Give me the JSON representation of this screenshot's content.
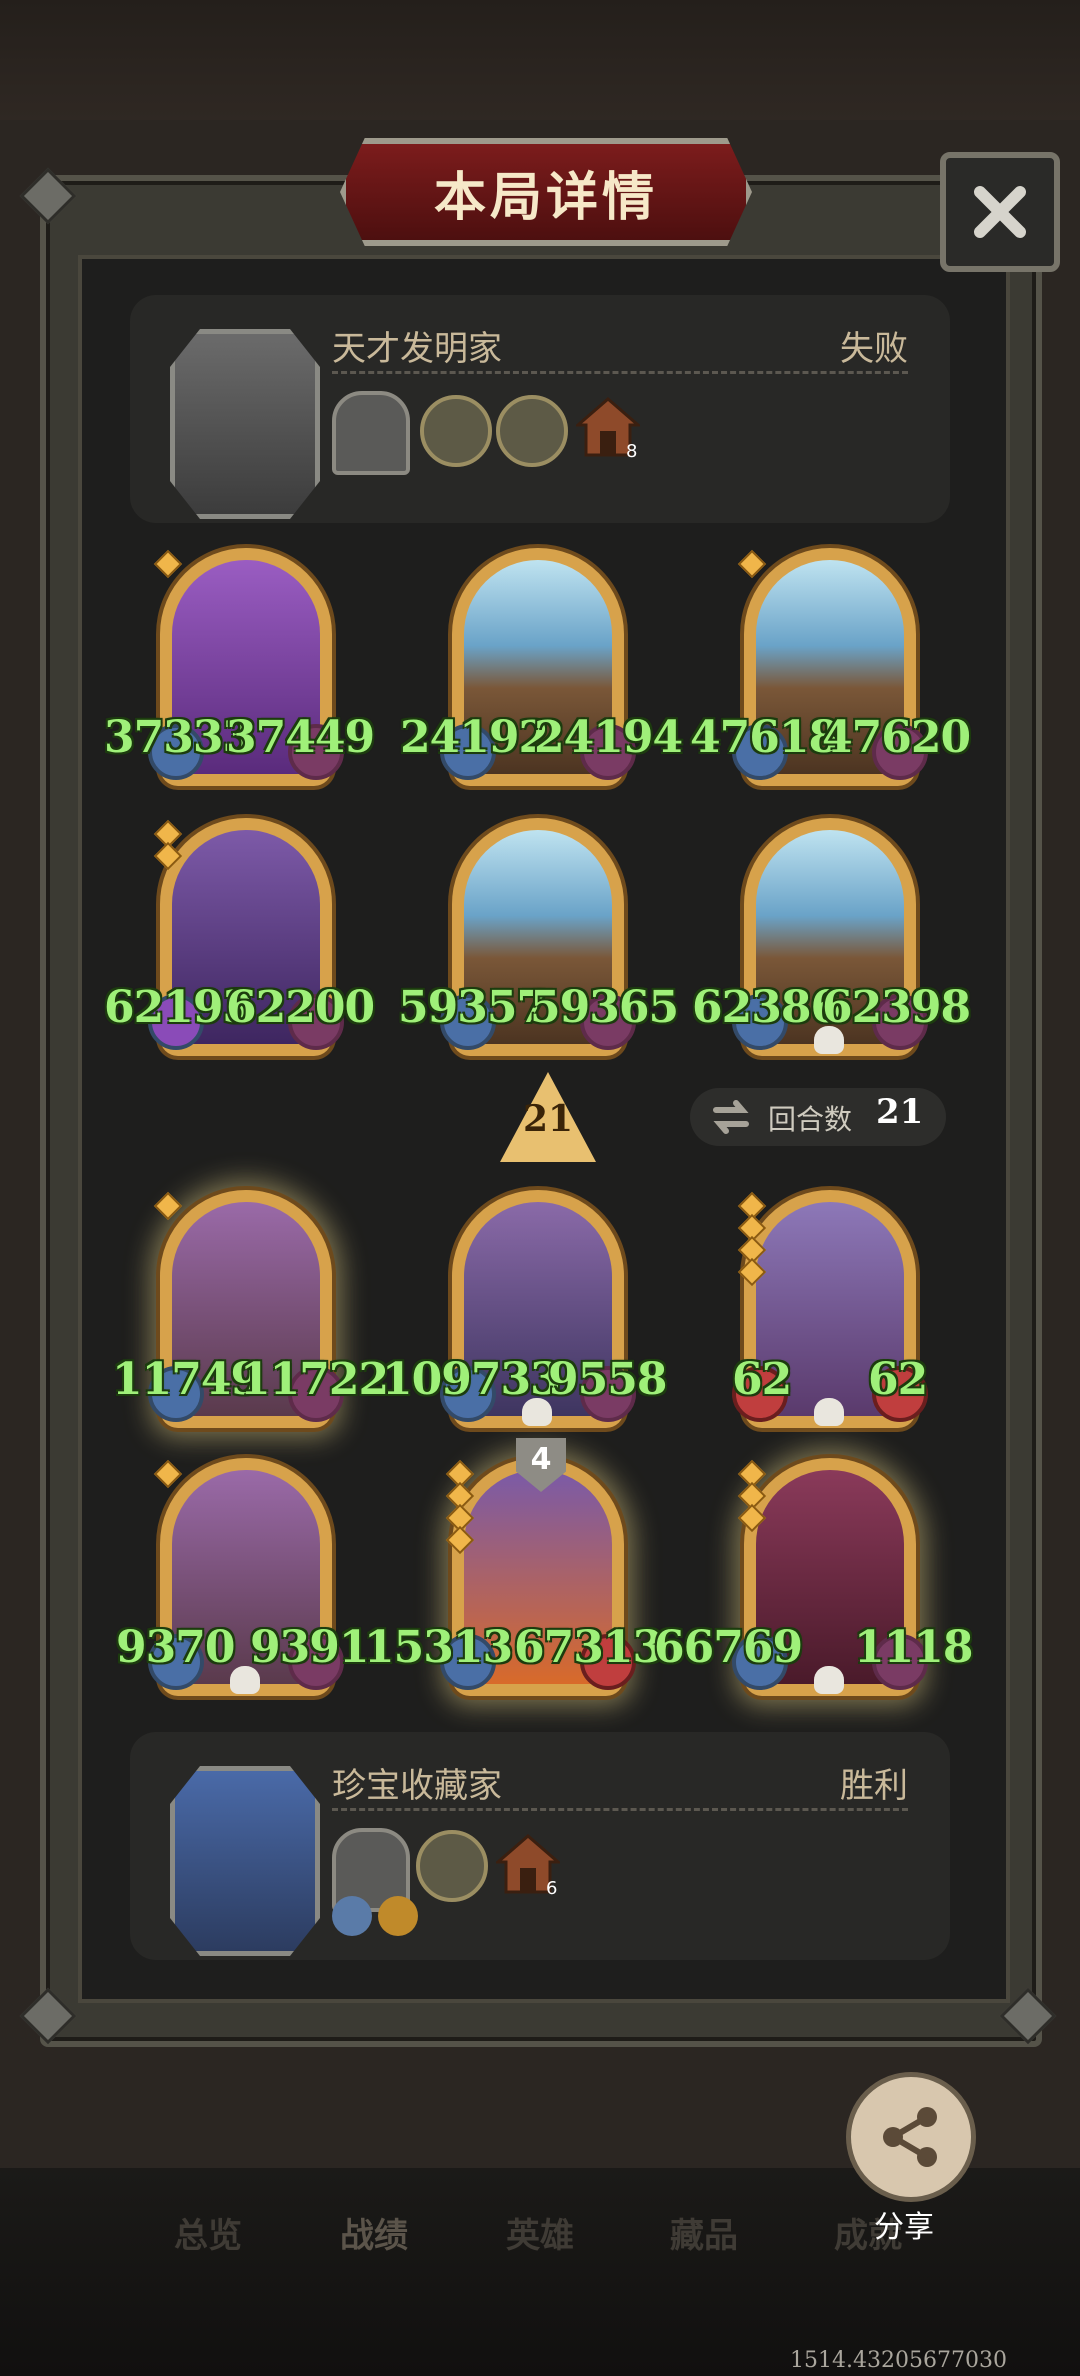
{
  "header": {
    "title": "本局详情"
  },
  "top_player": {
    "name": "天才发明家",
    "result": "失败",
    "house_level": "8"
  },
  "top_cards": [
    {
      "left_stat": "37333",
      "right_stat": "37449"
    },
    {
      "left_stat": "24192",
      "right_stat": "24194"
    },
    {
      "left_stat": "47618",
      "right_stat": "47620"
    },
    {
      "left_stat": "62193",
      "right_stat": "62200"
    },
    {
      "left_stat": "59357",
      "right_stat": "59365"
    },
    {
      "left_stat": "62386",
      "right_stat": "62398"
    }
  ],
  "tier_badge": {
    "value": "21"
  },
  "round_info": {
    "label": "回合数",
    "value": "21"
  },
  "bottom_cards": [
    {
      "left_stat": "11749",
      "right_stat": "11722"
    },
    {
      "left_stat": "109733",
      "right_stat": "9558"
    },
    {
      "left_stat": "62",
      "right_stat": "62"
    },
    {
      "left_stat": "9370",
      "right_stat": "9391"
    },
    {
      "left_stat": "15313",
      "right_stat": "67313",
      "tier": "4"
    },
    {
      "left_stat": "66769",
      "right_stat": "1118"
    }
  ],
  "bottom_player": {
    "name": "珍宝收藏家",
    "result": "胜利",
    "house_level": "6"
  },
  "share": {
    "label": "分享"
  },
  "nav": {
    "tabs": [
      "总览",
      "战绩",
      "英雄",
      "藏品",
      "成就"
    ]
  },
  "coordinates_text": "1514.43205677030",
  "colors": {
    "stat_green": "#9ff079",
    "title_red": "#7c1c1c",
    "card_gold": "#d7a24b"
  }
}
